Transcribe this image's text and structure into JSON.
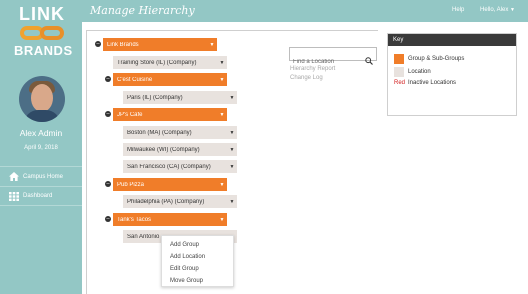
{
  "brand": {
    "line1": "LINK",
    "line2": "BRANDS"
  },
  "user": {
    "name": "Alex Admin",
    "date": "April 9, 2018"
  },
  "nav": {
    "items": [
      {
        "label": "Campus Home",
        "icon": "home-icon"
      },
      {
        "label": "Dashboard",
        "icon": "grid-icon"
      }
    ]
  },
  "header": {
    "title": "Manage Hierarchy",
    "help": "Help",
    "user_menu": "Hello, Alex"
  },
  "tree": {
    "root": "Link Brands",
    "training_store": "Training Store (IL) (Company)",
    "groups": [
      {
        "label": "C'est Cuisine",
        "locations": [
          "Paris (IL) (Company)"
        ]
      },
      {
        "label": "JP's Cafe",
        "locations": [
          "Boston (MA) (Company)",
          "Milwaukee (WI) (Company)",
          "San Francisco (CA) (Company)"
        ]
      },
      {
        "label": "Pub Pizza",
        "locations": [
          "Philadelphia (PA) (Company)"
        ]
      },
      {
        "label": "Tank's Tacos",
        "locations": [
          "San Antonio"
        ]
      }
    ]
  },
  "search": {
    "placeholder": "Find a Location"
  },
  "links": {
    "hierarchy_report": "Hierarchy Report",
    "change_log": "Change Log"
  },
  "context_menu": {
    "items": [
      "Add Group",
      "Add Location",
      "Edit Group",
      "Move Group"
    ]
  },
  "key": {
    "title": "Key",
    "group_label": "Group & Sub-Groups",
    "location_label": "Location",
    "inactive_prefix": "Red",
    "inactive_label": "Inactive Locations"
  },
  "colors": {
    "group": "#f07d29",
    "location": "#e8e2de",
    "sidebar": "#93c7c5",
    "inactive": "#d21e1e"
  }
}
